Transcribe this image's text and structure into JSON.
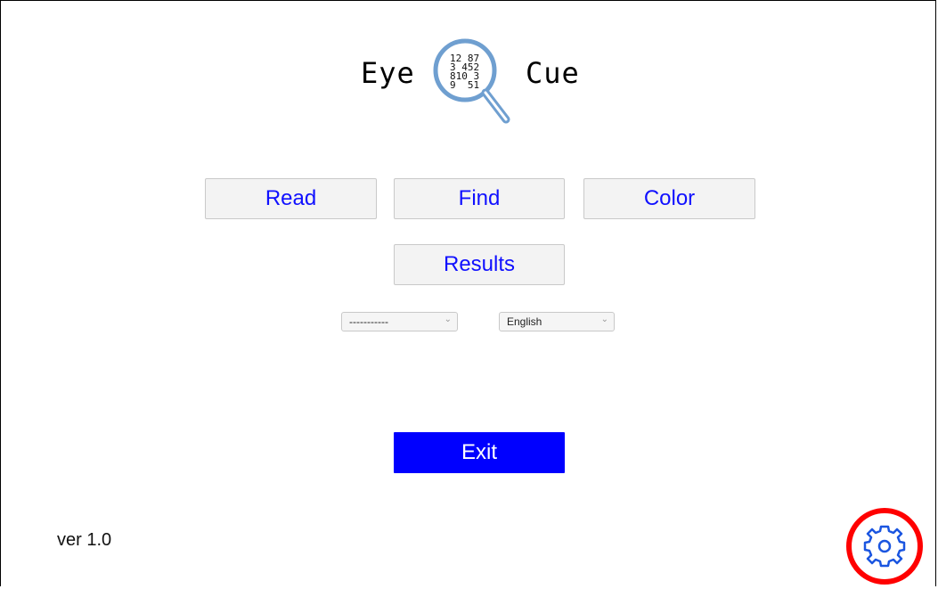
{
  "app": {
    "logo": {
      "word_left": "Eye",
      "word_right": "Cue",
      "lens_numbers": [
        "12 87",
        "3 452",
        "810 3",
        "9  51"
      ]
    }
  },
  "menu": {
    "read_label": "Read",
    "find_label": "Find",
    "color_label": "Color",
    "results_label": "Results",
    "exit_label": "Exit"
  },
  "selects": {
    "profile": {
      "value": "-----------"
    },
    "language": {
      "value": "English"
    }
  },
  "footer": {
    "version": "ver  1.0"
  },
  "icons": {
    "settings": "gear-icon",
    "dropdown": "chevron-down-icon",
    "logo": "magnifier-icon"
  },
  "colors": {
    "accent_blue": "#0000ff",
    "button_text": "#1010ff",
    "lens_blue": "#6f9fd0",
    "highlight_red": "#ff0000"
  }
}
